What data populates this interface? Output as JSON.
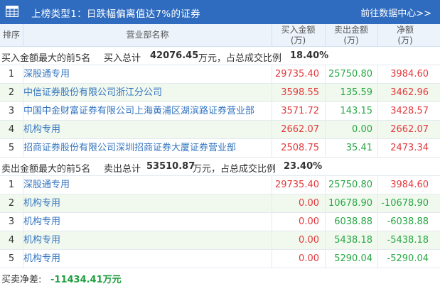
{
  "header": {
    "title": "上榜类型1：日跌幅偏离值达7%的证券",
    "link": "前往数据中心>>",
    "icon": "table-icon"
  },
  "columns": {
    "rank": "排序",
    "dept": "营业部名称",
    "buy_l1": "买入金额",
    "buy_l2": "(万)",
    "sell_l1": "卖出金额",
    "sell_l2": "(万)",
    "net_l1": "净额",
    "net_l2": "(万)"
  },
  "buy_section": {
    "prefix": "买入金额最大的前5名",
    "total_label": "买入总计",
    "total_value": "42076.45",
    "unit_text": "万元，占总成交比例",
    "ratio": "18.40%",
    "rows": [
      {
        "rank": "1",
        "name": "深股通专用",
        "buy": "29735.40",
        "sell": "25750.80",
        "net": "3984.60"
      },
      {
        "rank": "2",
        "name": "中信证券股份有限公司浙江分公司",
        "buy": "3598.55",
        "sell": "135.59",
        "net": "3462.96"
      },
      {
        "rank": "3",
        "name": "中国中金财富证券有限公司上海黄浦区湖滨路证券营业部",
        "buy": "3571.72",
        "sell": "143.15",
        "net": "3428.57"
      },
      {
        "rank": "4",
        "name": "机构专用",
        "buy": "2662.07",
        "sell": "0.00",
        "net": "2662.07"
      },
      {
        "rank": "5",
        "name": "招商证券股份有限公司深圳招商证券大厦证券营业部",
        "buy": "2508.75",
        "sell": "35.41",
        "net": "2473.34"
      }
    ]
  },
  "sell_section": {
    "prefix": "卖出金额最大的前5名",
    "total_label": "卖出总计",
    "total_value": "53510.87",
    "unit_text": "万元，占总成交比例",
    "ratio": "23.40%",
    "rows": [
      {
        "rank": "1",
        "name": "深股通专用",
        "buy": "29735.40",
        "sell": "25750.80",
        "net": "3984.60"
      },
      {
        "rank": "2",
        "name": "机构专用",
        "buy": "0.00",
        "sell": "10678.90",
        "net": "-10678.90"
      },
      {
        "rank": "3",
        "name": "机构专用",
        "buy": "0.00",
        "sell": "6038.88",
        "net": "-6038.88"
      },
      {
        "rank": "4",
        "name": "机构专用",
        "buy": "0.00",
        "sell": "5438.18",
        "net": "-5438.18"
      },
      {
        "rank": "5",
        "name": "机构专用",
        "buy": "0.00",
        "sell": "5290.04",
        "net": "-5290.04"
      }
    ]
  },
  "footer": {
    "label": "买卖净差:",
    "value": "-11434.41万元"
  },
  "colors": {
    "header_bg": "#2f6cc0",
    "link_blue": "#3374c0",
    "red": "#e4393c",
    "green": "#28a745",
    "row_alt": "#f1f9ee"
  }
}
